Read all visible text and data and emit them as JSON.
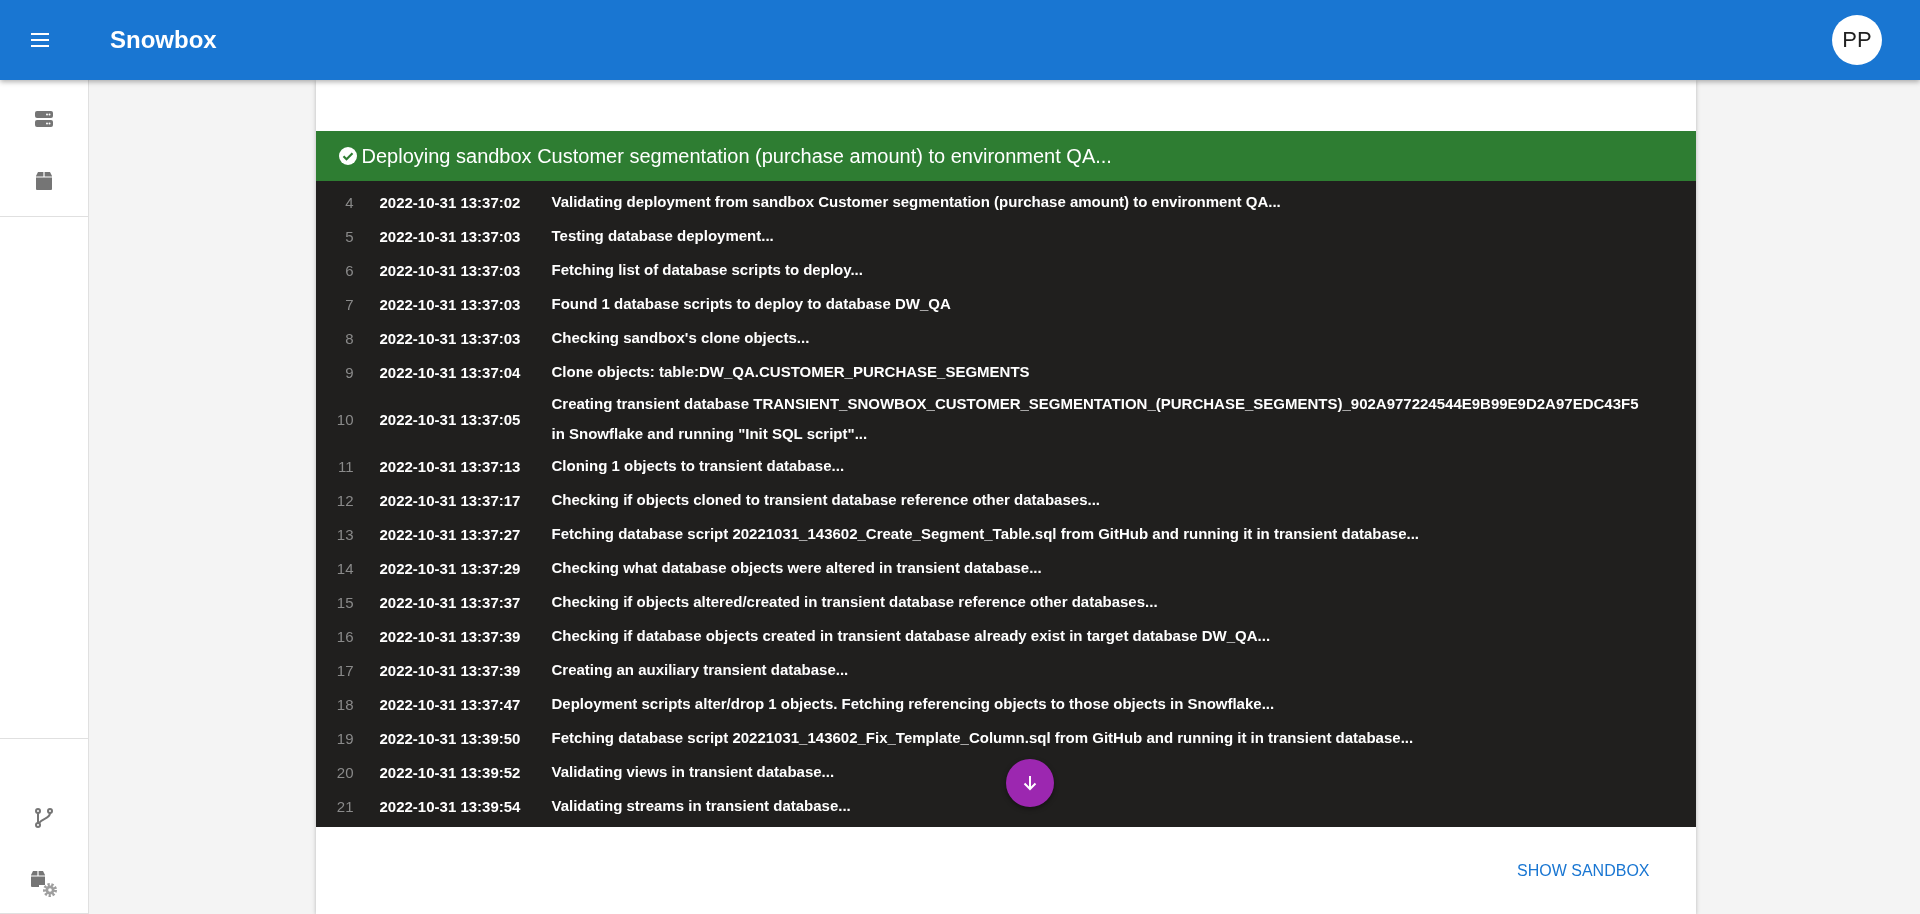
{
  "app_bar": {
    "title": "Snowbox",
    "avatar": "PP"
  },
  "sidebar": {
    "top_items": [
      {
        "kind": "databases"
      },
      {
        "kind": "package"
      }
    ],
    "bottom_items": [
      {
        "kind": "branch"
      },
      {
        "kind": "package-settings"
      }
    ]
  },
  "deployment": {
    "succeeded": true,
    "title": "Deploying sandbox Customer segmentation (purchase amount) to environment QA...",
    "log": [
      {
        "line": "4",
        "time": "2022-10-31 13:37:02",
        "message": "Validating deployment from sandbox Customer segmentation (purchase amount) to environment QA..."
      },
      {
        "line": "5",
        "time": "2022-10-31 13:37:03",
        "message": "Testing database deployment..."
      },
      {
        "line": "6",
        "time": "2022-10-31 13:37:03",
        "message": "Fetching list of database scripts to deploy..."
      },
      {
        "line": "7",
        "time": "2022-10-31 13:37:03",
        "message": "Found 1 database scripts to deploy to database DW_QA"
      },
      {
        "line": "8",
        "time": "2022-10-31 13:37:03",
        "message": "Checking sandbox's clone objects..."
      },
      {
        "line": "9",
        "time": "2022-10-31 13:37:04",
        "message": "Clone objects: table:DW_QA.CUSTOMER_PURCHASE_SEGMENTS"
      },
      {
        "line": "10",
        "time": "2022-10-31 13:37:05",
        "message": "Creating transient database TRANSIENT_SNOWBOX_CUSTOMER_SEGMENTATION_(PURCHASE_SEGMENTS)_902A977224544E9B99E9D2A97EDC43F5 in Snowflake and running \"Init SQL script\"..."
      },
      {
        "line": "11",
        "time": "2022-10-31 13:37:13",
        "message": "Cloning 1 objects to transient database..."
      },
      {
        "line": "12",
        "time": "2022-10-31 13:37:17",
        "message": "Checking if objects cloned to transient database reference other databases..."
      },
      {
        "line": "13",
        "time": "2022-10-31 13:37:27",
        "message": "Fetching database script 20221031_143602_Create_Segment_Table.sql from GitHub and running it in transient database..."
      },
      {
        "line": "14",
        "time": "2022-10-31 13:37:29",
        "message": "Checking what database objects were altered in transient database..."
      },
      {
        "line": "15",
        "time": "2022-10-31 13:37:37",
        "message": "Checking if objects altered/created in transient database reference other databases..."
      },
      {
        "line": "16",
        "time": "2022-10-31 13:37:39",
        "message": "Checking if database objects created in transient database already exist in target database DW_QA..."
      },
      {
        "line": "17",
        "time": "2022-10-31 13:37:39",
        "message": "Creating an auxiliary transient database..."
      },
      {
        "line": "18",
        "time": "2022-10-31 13:37:47",
        "message": "Deployment scripts alter/drop 1 objects. Fetching referencing objects to those objects in Snowflake..."
      },
      {
        "line": "19",
        "time": "2022-10-31 13:39:50",
        "message": "Fetching database script 20221031_143602_Fix_Template_Column.sql from GitHub and running it in transient database..."
      },
      {
        "line": "20",
        "time": "2022-10-31 13:39:52",
        "message": "Validating views in transient database..."
      },
      {
        "line": "21",
        "time": "2022-10-31 13:39:54",
        "message": "Validating streams in transient database..."
      }
    ],
    "action": "SHOW SANDBOX"
  }
}
